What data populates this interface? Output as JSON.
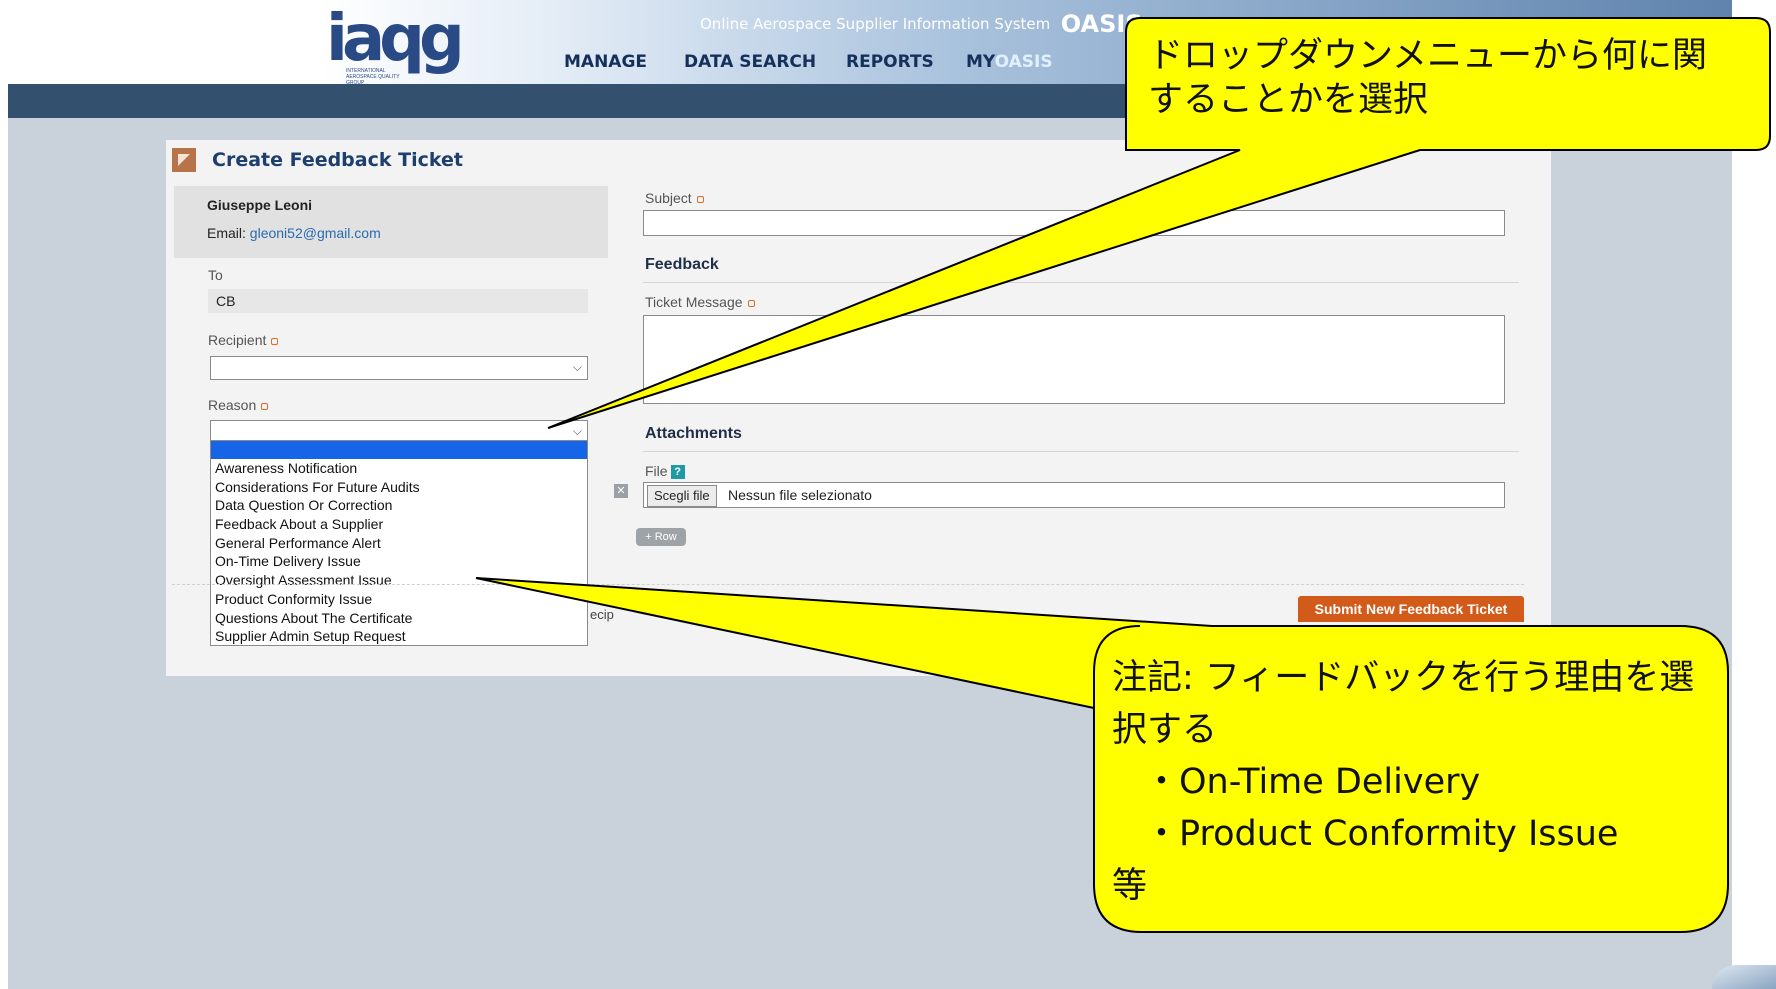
{
  "header": {
    "logo_text": "iaqg",
    "logo_subtext": "INTERNATIONAL AEROSPACE QUALITY GROUP",
    "system_name": "Online Aerospace Supplier Information System",
    "system_short": "OASIS",
    "nav": [
      "MANAGE",
      "DATA SEARCH",
      "REPORTS"
    ],
    "nav_myoasis_prefix": "MY",
    "nav_myoasis_suffix": "OASIS"
  },
  "page": {
    "title": "Create Feedback Ticket",
    "user_name": "Giuseppe Leoni",
    "email_label": "Email:",
    "email": "gleoni52@gmail.com",
    "to_label": "To",
    "to_value": "CB",
    "recipient_label": "Recipient",
    "recipient_value": "",
    "reason_label": "Reason",
    "reason_value": "",
    "reason_options": [
      "",
      "Awareness Notification",
      "Considerations For Future Audits",
      "Data Question Or Correction",
      "Feedback About a Supplier",
      "General Performance Alert",
      "On-Time Delivery Issue",
      "Oversight Assessment Issue",
      "Product Conformity Issue",
      "Questions About The Certificate",
      "Supplier Admin Setup Request"
    ],
    "partial_text": "ecip",
    "subject_label": "Subject",
    "subject_value": "",
    "feedback_heading": "Feedback",
    "ticket_message_label": "Ticket Message",
    "ticket_message_value": "",
    "attachments_heading": "Attachments",
    "file_label": "File",
    "help_glyph": "?",
    "remove_glyph": "✕",
    "choose_file_button": "Scegli file",
    "no_file_text": "Nessun file selezionato",
    "add_row_button": "+ Row",
    "submit_button": "Submit New Feedback Ticket"
  },
  "annotations": {
    "callout_top": "ドロップダウンメニューから何に関することかを選択",
    "callout_bottom_line1": "注記: フィードバックを行う理由を選択する",
    "callout_bottom_bullet1": "・On-Time Delivery",
    "callout_bottom_bullet2": "・Product Conformity Issue",
    "callout_bottom_line_end": "等",
    "callout_fill": "#ffff00",
    "callout_stroke": "#000000"
  },
  "colors": {
    "accent_orange": "#d35b1a",
    "header_dark": "#34506f",
    "link_blue": "#2a6bb0",
    "dropdown_highlight": "#1565e6"
  }
}
